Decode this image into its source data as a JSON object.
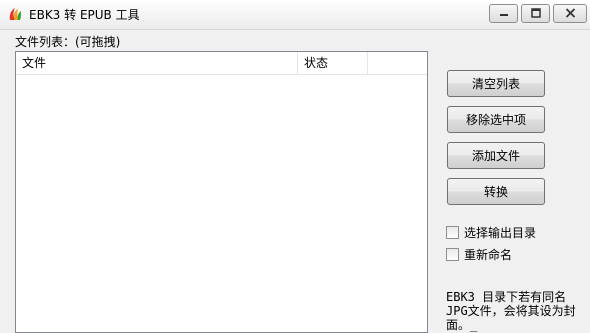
{
  "window": {
    "title": "EBK3 转 EPUB 工具"
  },
  "file_list": {
    "label": "文件列表：(可拖拽)",
    "columns": [
      "文件",
      "状态",
      ""
    ],
    "rows": []
  },
  "buttons": {
    "clear": "清空列表",
    "remove": "移除选中项",
    "add": "添加文件",
    "convert": "转换"
  },
  "options": {
    "output_dir": {
      "label": "选择输出目录",
      "checked": false
    },
    "rename": {
      "label": "重新命名",
      "checked": false
    }
  },
  "note": "EBK3 目录下若有同名JPG文件，会将其设为封面。_",
  "colors": {
    "window_bg": "#f0f0f0",
    "close_button": "#c75050",
    "list_border": "#828790"
  },
  "icons": {
    "app": "app-logo-icon",
    "minimize": "minimize-icon",
    "maximize": "maximize-icon",
    "close": "close-icon"
  }
}
